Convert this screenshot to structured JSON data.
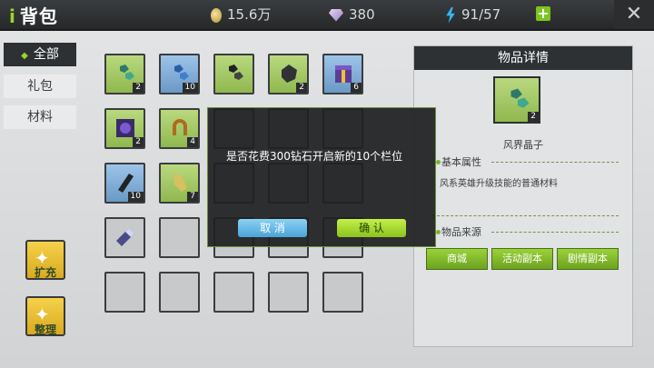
{
  "header": {
    "title": "背包",
    "gold": "15.6万",
    "diamonds": "380",
    "energy": "91/57"
  },
  "tabs": [
    "全部",
    "礼包",
    "材料"
  ],
  "side_buttons": [
    "扩充",
    "整理"
  ],
  "grid_counts": {
    "r0c0": "2",
    "r0c1": "10",
    "r0c3": "2",
    "r0c4": "6",
    "r1c0": "2",
    "r1c1": "4",
    "r2c0": "10",
    "r2c1": "7"
  },
  "detail": {
    "heading": "物品详情",
    "item_count": "2",
    "item_name": "风界晶子",
    "basic_attr_title": "基本属性",
    "description": "风系英雄升级技能的普通材料",
    "source_title": "物品来源",
    "sources": [
      "商城",
      "活动副本",
      "剧情副本"
    ]
  },
  "dialog": {
    "message": "是否花费300钻石开启新的10个栏位",
    "cancel_label": "取 消",
    "confirm_label": "确 认"
  },
  "colors": {
    "accent_green": "#8cc21c",
    "dark_panel": "#2e3134",
    "cancel_blue": "#4aa3d7"
  }
}
